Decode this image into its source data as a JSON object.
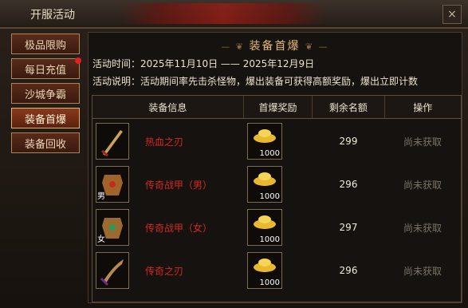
{
  "window": {
    "title": "开服活动",
    "close_label": "×"
  },
  "sidebar": {
    "items": [
      {
        "label": "极品限购",
        "active": false,
        "badge": false
      },
      {
        "label": "每日充值",
        "active": false,
        "badge": true
      },
      {
        "label": "沙城争霸",
        "active": false,
        "badge": false
      },
      {
        "label": "装备首爆",
        "active": true,
        "badge": false
      },
      {
        "label": "装备回收",
        "active": false,
        "badge": false
      }
    ]
  },
  "main": {
    "section_title": "装备首爆",
    "time_line": "活动时间：2025年11月10日 —— 2025年12月9日",
    "desc_line": "活动说明：活动期间率先击杀怪物，爆出装备可获得高额奖励，爆出立即计数",
    "table": {
      "headers": [
        "装备信息",
        "首爆奖励",
        "剩余名额",
        "操作"
      ],
      "rows": [
        {
          "name": "热血之刃",
          "gender": "",
          "icon": "sword-icon",
          "reward": "1000",
          "reward_icon": "gold-ingot-icon",
          "remaining": "299",
          "action": "尚未获取"
        },
        {
          "name": "传奇战甲（男）",
          "gender": "男",
          "icon": "armor-icon",
          "reward": "1000",
          "reward_icon": "gold-ingot-icon",
          "remaining": "296",
          "action": "尚未获取"
        },
        {
          "name": "传奇战甲（女）",
          "gender": "女",
          "icon": "armor-icon",
          "reward": "1000",
          "reward_icon": "gold-ingot-icon",
          "remaining": "297",
          "action": "尚未获取"
        },
        {
          "name": "传奇之刃",
          "gender": "",
          "icon": "blade-icon",
          "reward": "1000",
          "reward_icon": "gold-ingot-icon",
          "remaining": "296",
          "action": "尚未获取"
        }
      ]
    }
  }
}
